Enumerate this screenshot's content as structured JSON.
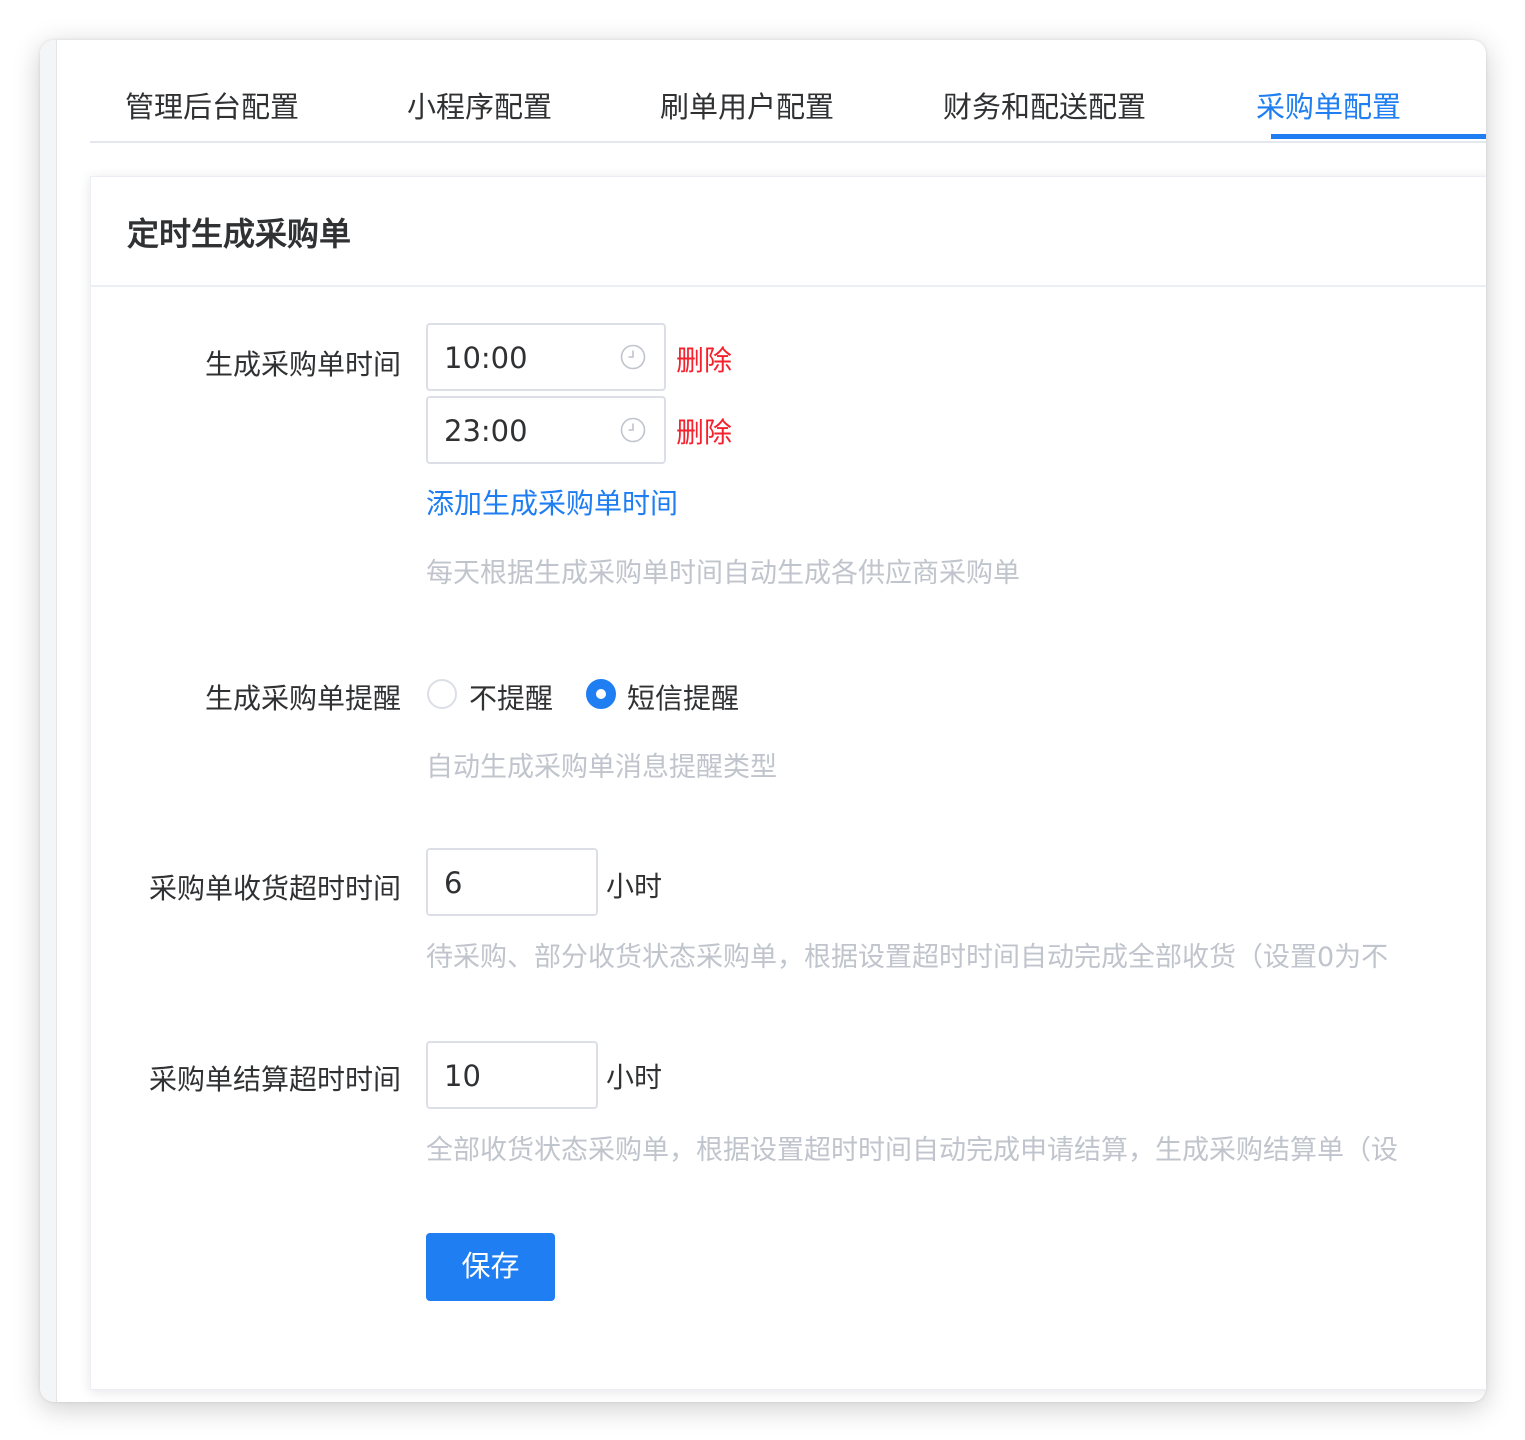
{
  "tabs": [
    {
      "label": "管理后台配置",
      "active": false
    },
    {
      "label": "小程序配置",
      "active": false
    },
    {
      "label": "刷单用户配置",
      "active": false
    },
    {
      "label": "财务和配送配置",
      "active": false
    },
    {
      "label": "采购单配置",
      "active": true
    }
  ],
  "card": {
    "title": "定时生成采购单",
    "generate_time": {
      "label": "生成采购单时间",
      "times": [
        "10:00",
        "23:00"
      ],
      "delete_label": "删除",
      "add_label": "添加生成采购单时间",
      "hint": "每天根据生成采购单时间自动生成各供应商采购单"
    },
    "reminder": {
      "label": "生成采购单提醒",
      "options": [
        "不提醒",
        "短信提醒"
      ],
      "selected": "短信提醒",
      "hint": "自动生成采购单消息提醒类型"
    },
    "receive_timeout": {
      "label": "采购单收货超时时间",
      "value": "6",
      "unit": "小时",
      "hint": "待采购、部分收货状态采购单，根据设置超时时间自动完成全部收货（设置0为不"
    },
    "settle_timeout": {
      "label": "采购单结算超时时间",
      "value": "10",
      "unit": "小时",
      "hint": "全部收货状态采购单，根据设置超时时间自动完成申请结算，生成采购结算单（设"
    },
    "save_label": "保存"
  },
  "colors": {
    "accent": "#1e7ef2",
    "danger": "#f5222d",
    "hint": "#c0c4cc",
    "text": "#303133"
  }
}
